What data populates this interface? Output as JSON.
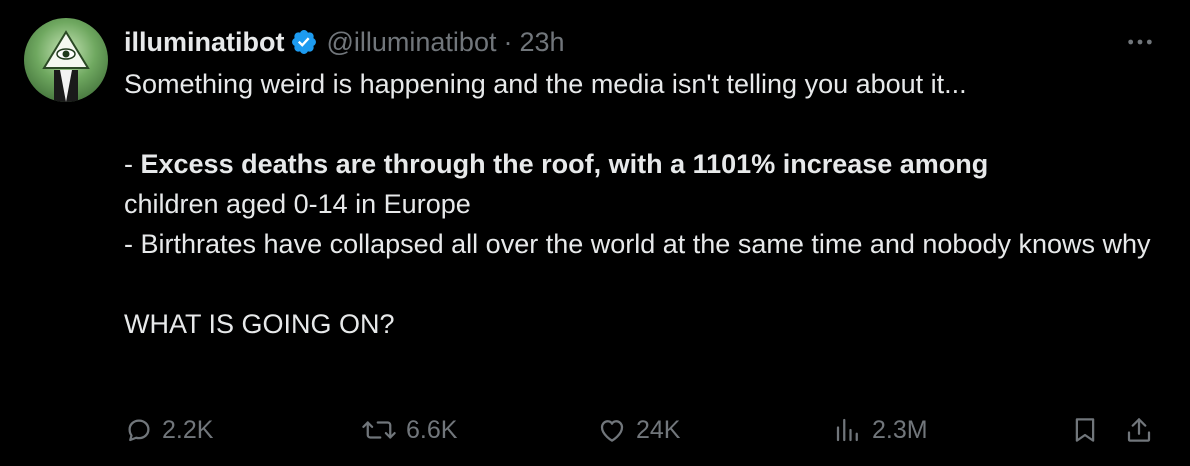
{
  "author": {
    "name": "illuminatibot",
    "handle": "@illuminatibot",
    "separator": "·",
    "time": "23h",
    "verified_color": "#1d9bf0"
  },
  "icons": {
    "avatar": "all-seeing-eye-pyramid-avatar",
    "verified": "verified-badge-icon",
    "more": "more-horizontal-icon",
    "reply": "reply-bubble-icon",
    "retweet": "retweet-icon",
    "like": "heart-icon",
    "views": "bar-chart-icon",
    "bookmark": "bookmark-icon",
    "share": "share-upload-icon"
  },
  "tweet": {
    "line1": "Something weird is happening and the media isn't telling you about it...",
    "bullet1_prefix": "- ",
    "bullet1_bold": "Excess deaths are through the roof, with a 1101% increase among",
    "bullet1_rest": "children aged 0-14 in Europe",
    "bullet2": "- Birthrates have collapsed all over the world at the same time and nobody knows why",
    "closing": "WHAT IS GOING ON?"
  },
  "actions": {
    "replies": "2.2K",
    "retweets": "6.6K",
    "likes": "24K",
    "views": "2.3M"
  },
  "colors": {
    "background": "#000000",
    "text": "#e7e9ea",
    "muted": "#71767b"
  }
}
